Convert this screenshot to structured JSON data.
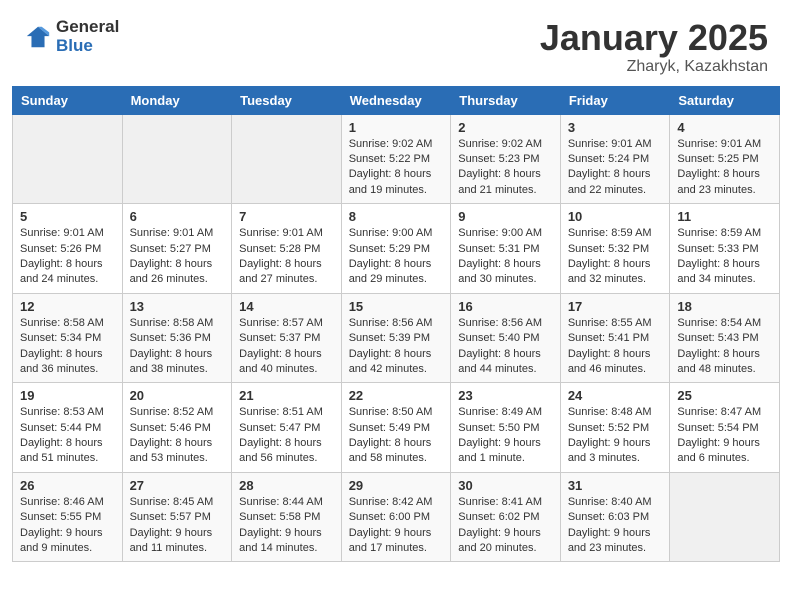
{
  "header": {
    "logo_general": "General",
    "logo_blue": "Blue",
    "title": "January 2025",
    "subtitle": "Zharyk, Kazakhstan"
  },
  "days_of_week": [
    "Sunday",
    "Monday",
    "Tuesday",
    "Wednesday",
    "Thursday",
    "Friday",
    "Saturday"
  ],
  "weeks": [
    [
      {
        "day": "",
        "sunrise": "",
        "sunset": "",
        "daylight": ""
      },
      {
        "day": "",
        "sunrise": "",
        "sunset": "",
        "daylight": ""
      },
      {
        "day": "",
        "sunrise": "",
        "sunset": "",
        "daylight": ""
      },
      {
        "day": "1",
        "sunrise": "Sunrise: 9:02 AM",
        "sunset": "Sunset: 5:22 PM",
        "daylight": "Daylight: 8 hours and 19 minutes."
      },
      {
        "day": "2",
        "sunrise": "Sunrise: 9:02 AM",
        "sunset": "Sunset: 5:23 PM",
        "daylight": "Daylight: 8 hours and 21 minutes."
      },
      {
        "day": "3",
        "sunrise": "Sunrise: 9:01 AM",
        "sunset": "Sunset: 5:24 PM",
        "daylight": "Daylight: 8 hours and 22 minutes."
      },
      {
        "day": "4",
        "sunrise": "Sunrise: 9:01 AM",
        "sunset": "Sunset: 5:25 PM",
        "daylight": "Daylight: 8 hours and 23 minutes."
      }
    ],
    [
      {
        "day": "5",
        "sunrise": "Sunrise: 9:01 AM",
        "sunset": "Sunset: 5:26 PM",
        "daylight": "Daylight: 8 hours and 24 minutes."
      },
      {
        "day": "6",
        "sunrise": "Sunrise: 9:01 AM",
        "sunset": "Sunset: 5:27 PM",
        "daylight": "Daylight: 8 hours and 26 minutes."
      },
      {
        "day": "7",
        "sunrise": "Sunrise: 9:01 AM",
        "sunset": "Sunset: 5:28 PM",
        "daylight": "Daylight: 8 hours and 27 minutes."
      },
      {
        "day": "8",
        "sunrise": "Sunrise: 9:00 AM",
        "sunset": "Sunset: 5:29 PM",
        "daylight": "Daylight: 8 hours and 29 minutes."
      },
      {
        "day": "9",
        "sunrise": "Sunrise: 9:00 AM",
        "sunset": "Sunset: 5:31 PM",
        "daylight": "Daylight: 8 hours and 30 minutes."
      },
      {
        "day": "10",
        "sunrise": "Sunrise: 8:59 AM",
        "sunset": "Sunset: 5:32 PM",
        "daylight": "Daylight: 8 hours and 32 minutes."
      },
      {
        "day": "11",
        "sunrise": "Sunrise: 8:59 AM",
        "sunset": "Sunset: 5:33 PM",
        "daylight": "Daylight: 8 hours and 34 minutes."
      }
    ],
    [
      {
        "day": "12",
        "sunrise": "Sunrise: 8:58 AM",
        "sunset": "Sunset: 5:34 PM",
        "daylight": "Daylight: 8 hours and 36 minutes."
      },
      {
        "day": "13",
        "sunrise": "Sunrise: 8:58 AM",
        "sunset": "Sunset: 5:36 PM",
        "daylight": "Daylight: 8 hours and 38 minutes."
      },
      {
        "day": "14",
        "sunrise": "Sunrise: 8:57 AM",
        "sunset": "Sunset: 5:37 PM",
        "daylight": "Daylight: 8 hours and 40 minutes."
      },
      {
        "day": "15",
        "sunrise": "Sunrise: 8:56 AM",
        "sunset": "Sunset: 5:39 PM",
        "daylight": "Daylight: 8 hours and 42 minutes."
      },
      {
        "day": "16",
        "sunrise": "Sunrise: 8:56 AM",
        "sunset": "Sunset: 5:40 PM",
        "daylight": "Daylight: 8 hours and 44 minutes."
      },
      {
        "day": "17",
        "sunrise": "Sunrise: 8:55 AM",
        "sunset": "Sunset: 5:41 PM",
        "daylight": "Daylight: 8 hours and 46 minutes."
      },
      {
        "day": "18",
        "sunrise": "Sunrise: 8:54 AM",
        "sunset": "Sunset: 5:43 PM",
        "daylight": "Daylight: 8 hours and 48 minutes."
      }
    ],
    [
      {
        "day": "19",
        "sunrise": "Sunrise: 8:53 AM",
        "sunset": "Sunset: 5:44 PM",
        "daylight": "Daylight: 8 hours and 51 minutes."
      },
      {
        "day": "20",
        "sunrise": "Sunrise: 8:52 AM",
        "sunset": "Sunset: 5:46 PM",
        "daylight": "Daylight: 8 hours and 53 minutes."
      },
      {
        "day": "21",
        "sunrise": "Sunrise: 8:51 AM",
        "sunset": "Sunset: 5:47 PM",
        "daylight": "Daylight: 8 hours and 56 minutes."
      },
      {
        "day": "22",
        "sunrise": "Sunrise: 8:50 AM",
        "sunset": "Sunset: 5:49 PM",
        "daylight": "Daylight: 8 hours and 58 minutes."
      },
      {
        "day": "23",
        "sunrise": "Sunrise: 8:49 AM",
        "sunset": "Sunset: 5:50 PM",
        "daylight": "Daylight: 9 hours and 1 minute."
      },
      {
        "day": "24",
        "sunrise": "Sunrise: 8:48 AM",
        "sunset": "Sunset: 5:52 PM",
        "daylight": "Daylight: 9 hours and 3 minutes."
      },
      {
        "day": "25",
        "sunrise": "Sunrise: 8:47 AM",
        "sunset": "Sunset: 5:54 PM",
        "daylight": "Daylight: 9 hours and 6 minutes."
      }
    ],
    [
      {
        "day": "26",
        "sunrise": "Sunrise: 8:46 AM",
        "sunset": "Sunset: 5:55 PM",
        "daylight": "Daylight: 9 hours and 9 minutes."
      },
      {
        "day": "27",
        "sunrise": "Sunrise: 8:45 AM",
        "sunset": "Sunset: 5:57 PM",
        "daylight": "Daylight: 9 hours and 11 minutes."
      },
      {
        "day": "28",
        "sunrise": "Sunrise: 8:44 AM",
        "sunset": "Sunset: 5:58 PM",
        "daylight": "Daylight: 9 hours and 14 minutes."
      },
      {
        "day": "29",
        "sunrise": "Sunrise: 8:42 AM",
        "sunset": "Sunset: 6:00 PM",
        "daylight": "Daylight: 9 hours and 17 minutes."
      },
      {
        "day": "30",
        "sunrise": "Sunrise: 8:41 AM",
        "sunset": "Sunset: 6:02 PM",
        "daylight": "Daylight: 9 hours and 20 minutes."
      },
      {
        "day": "31",
        "sunrise": "Sunrise: 8:40 AM",
        "sunset": "Sunset: 6:03 PM",
        "daylight": "Daylight: 9 hours and 23 minutes."
      },
      {
        "day": "",
        "sunrise": "",
        "sunset": "",
        "daylight": ""
      }
    ]
  ]
}
